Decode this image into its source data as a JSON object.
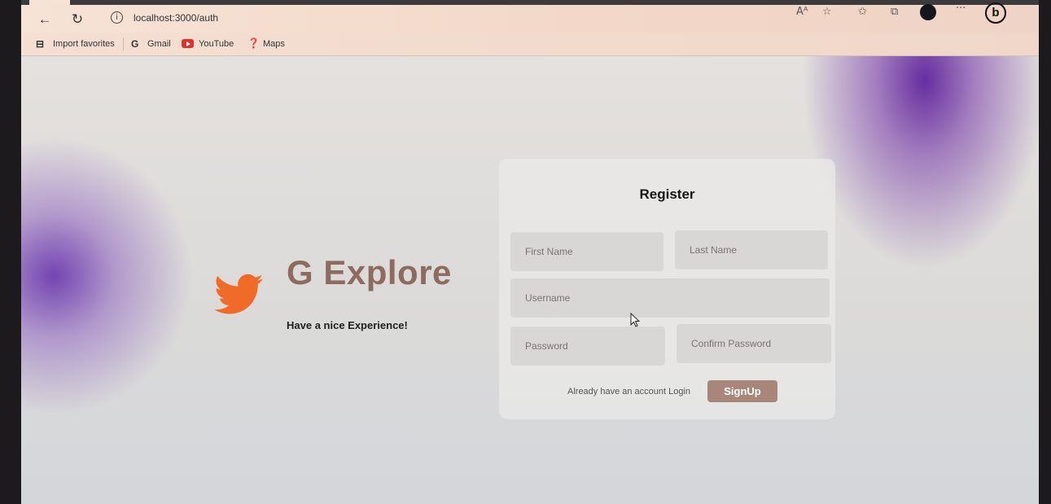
{
  "browser": {
    "url": "localhost:3000/auth",
    "bookmarks": [
      "Import favorites",
      "Gmail",
      "YouTube",
      "Maps"
    ]
  },
  "brand": {
    "title": "G Explore",
    "subtitle": "Have a nice Experience!"
  },
  "form": {
    "title": "Register",
    "first_name_placeholder": "First Name",
    "last_name_placeholder": "Last Name",
    "username_placeholder": "Username",
    "password_placeholder": "Password",
    "confirm_password_placeholder": "Confirm Password",
    "login_prompt": "Already have an account Login",
    "submit_label": "SignUp"
  },
  "colors": {
    "brand_title": "#8e6b5e",
    "button": "#a8877a",
    "logo": "#f06a28",
    "accent_purple": "#6a2c9c"
  },
  "icons": [
    "back-icon",
    "refresh-icon",
    "info-icon",
    "read-aloud-icon",
    "favorite-icon",
    "favorites-list-icon",
    "collections-icon",
    "profile-icon",
    "more-icon",
    "bing-icon",
    "twitter-bird-icon"
  ]
}
